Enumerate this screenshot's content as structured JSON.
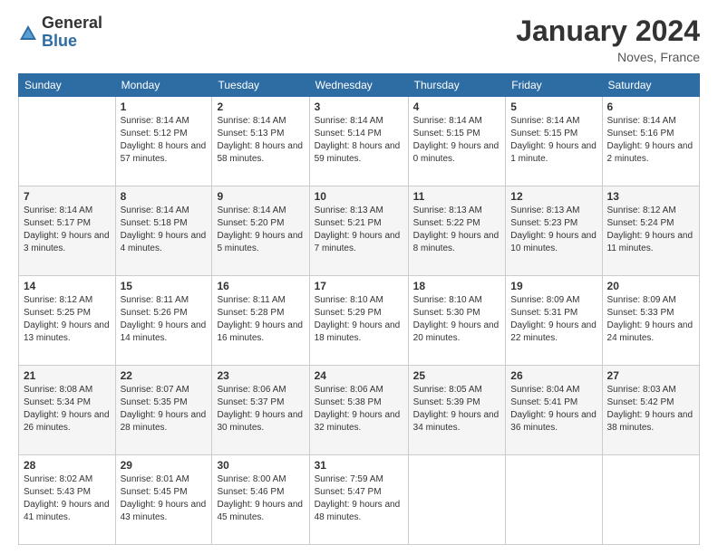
{
  "logo": {
    "general": "General",
    "blue": "Blue"
  },
  "header": {
    "title": "January 2024",
    "location": "Noves, France"
  },
  "weekdays": [
    "Sunday",
    "Monday",
    "Tuesday",
    "Wednesday",
    "Thursday",
    "Friday",
    "Saturday"
  ],
  "weeks": [
    [
      {
        "day": "",
        "sunrise": "",
        "sunset": "",
        "daylight": ""
      },
      {
        "day": "1",
        "sunrise": "Sunrise: 8:14 AM",
        "sunset": "Sunset: 5:12 PM",
        "daylight": "Daylight: 8 hours and 57 minutes."
      },
      {
        "day": "2",
        "sunrise": "Sunrise: 8:14 AM",
        "sunset": "Sunset: 5:13 PM",
        "daylight": "Daylight: 8 hours and 58 minutes."
      },
      {
        "day": "3",
        "sunrise": "Sunrise: 8:14 AM",
        "sunset": "Sunset: 5:14 PM",
        "daylight": "Daylight: 8 hours and 59 minutes."
      },
      {
        "day": "4",
        "sunrise": "Sunrise: 8:14 AM",
        "sunset": "Sunset: 5:15 PM",
        "daylight": "Daylight: 9 hours and 0 minutes."
      },
      {
        "day": "5",
        "sunrise": "Sunrise: 8:14 AM",
        "sunset": "Sunset: 5:15 PM",
        "daylight": "Daylight: 9 hours and 1 minute."
      },
      {
        "day": "6",
        "sunrise": "Sunrise: 8:14 AM",
        "sunset": "Sunset: 5:16 PM",
        "daylight": "Daylight: 9 hours and 2 minutes."
      }
    ],
    [
      {
        "day": "7",
        "sunrise": "Sunrise: 8:14 AM",
        "sunset": "Sunset: 5:17 PM",
        "daylight": "Daylight: 9 hours and 3 minutes."
      },
      {
        "day": "8",
        "sunrise": "Sunrise: 8:14 AM",
        "sunset": "Sunset: 5:18 PM",
        "daylight": "Daylight: 9 hours and 4 minutes."
      },
      {
        "day": "9",
        "sunrise": "Sunrise: 8:14 AM",
        "sunset": "Sunset: 5:20 PM",
        "daylight": "Daylight: 9 hours and 5 minutes."
      },
      {
        "day": "10",
        "sunrise": "Sunrise: 8:13 AM",
        "sunset": "Sunset: 5:21 PM",
        "daylight": "Daylight: 9 hours and 7 minutes."
      },
      {
        "day": "11",
        "sunrise": "Sunrise: 8:13 AM",
        "sunset": "Sunset: 5:22 PM",
        "daylight": "Daylight: 9 hours and 8 minutes."
      },
      {
        "day": "12",
        "sunrise": "Sunrise: 8:13 AM",
        "sunset": "Sunset: 5:23 PM",
        "daylight": "Daylight: 9 hours and 10 minutes."
      },
      {
        "day": "13",
        "sunrise": "Sunrise: 8:12 AM",
        "sunset": "Sunset: 5:24 PM",
        "daylight": "Daylight: 9 hours and 11 minutes."
      }
    ],
    [
      {
        "day": "14",
        "sunrise": "Sunrise: 8:12 AM",
        "sunset": "Sunset: 5:25 PM",
        "daylight": "Daylight: 9 hours and 13 minutes."
      },
      {
        "day": "15",
        "sunrise": "Sunrise: 8:11 AM",
        "sunset": "Sunset: 5:26 PM",
        "daylight": "Daylight: 9 hours and 14 minutes."
      },
      {
        "day": "16",
        "sunrise": "Sunrise: 8:11 AM",
        "sunset": "Sunset: 5:28 PM",
        "daylight": "Daylight: 9 hours and 16 minutes."
      },
      {
        "day": "17",
        "sunrise": "Sunrise: 8:10 AM",
        "sunset": "Sunset: 5:29 PM",
        "daylight": "Daylight: 9 hours and 18 minutes."
      },
      {
        "day": "18",
        "sunrise": "Sunrise: 8:10 AM",
        "sunset": "Sunset: 5:30 PM",
        "daylight": "Daylight: 9 hours and 20 minutes."
      },
      {
        "day": "19",
        "sunrise": "Sunrise: 8:09 AM",
        "sunset": "Sunset: 5:31 PM",
        "daylight": "Daylight: 9 hours and 22 minutes."
      },
      {
        "day": "20",
        "sunrise": "Sunrise: 8:09 AM",
        "sunset": "Sunset: 5:33 PM",
        "daylight": "Daylight: 9 hours and 24 minutes."
      }
    ],
    [
      {
        "day": "21",
        "sunrise": "Sunrise: 8:08 AM",
        "sunset": "Sunset: 5:34 PM",
        "daylight": "Daylight: 9 hours and 26 minutes."
      },
      {
        "day": "22",
        "sunrise": "Sunrise: 8:07 AM",
        "sunset": "Sunset: 5:35 PM",
        "daylight": "Daylight: 9 hours and 28 minutes."
      },
      {
        "day": "23",
        "sunrise": "Sunrise: 8:06 AM",
        "sunset": "Sunset: 5:37 PM",
        "daylight": "Daylight: 9 hours and 30 minutes."
      },
      {
        "day": "24",
        "sunrise": "Sunrise: 8:06 AM",
        "sunset": "Sunset: 5:38 PM",
        "daylight": "Daylight: 9 hours and 32 minutes."
      },
      {
        "day": "25",
        "sunrise": "Sunrise: 8:05 AM",
        "sunset": "Sunset: 5:39 PM",
        "daylight": "Daylight: 9 hours and 34 minutes."
      },
      {
        "day": "26",
        "sunrise": "Sunrise: 8:04 AM",
        "sunset": "Sunset: 5:41 PM",
        "daylight": "Daylight: 9 hours and 36 minutes."
      },
      {
        "day": "27",
        "sunrise": "Sunrise: 8:03 AM",
        "sunset": "Sunset: 5:42 PM",
        "daylight": "Daylight: 9 hours and 38 minutes."
      }
    ],
    [
      {
        "day": "28",
        "sunrise": "Sunrise: 8:02 AM",
        "sunset": "Sunset: 5:43 PM",
        "daylight": "Daylight: 9 hours and 41 minutes."
      },
      {
        "day": "29",
        "sunrise": "Sunrise: 8:01 AM",
        "sunset": "Sunset: 5:45 PM",
        "daylight": "Daylight: 9 hours and 43 minutes."
      },
      {
        "day": "30",
        "sunrise": "Sunrise: 8:00 AM",
        "sunset": "Sunset: 5:46 PM",
        "daylight": "Daylight: 9 hours and 45 minutes."
      },
      {
        "day": "31",
        "sunrise": "Sunrise: 7:59 AM",
        "sunset": "Sunset: 5:47 PM",
        "daylight": "Daylight: 9 hours and 48 minutes."
      },
      {
        "day": "",
        "sunrise": "",
        "sunset": "",
        "daylight": ""
      },
      {
        "day": "",
        "sunrise": "",
        "sunset": "",
        "daylight": ""
      },
      {
        "day": "",
        "sunrise": "",
        "sunset": "",
        "daylight": ""
      }
    ]
  ]
}
